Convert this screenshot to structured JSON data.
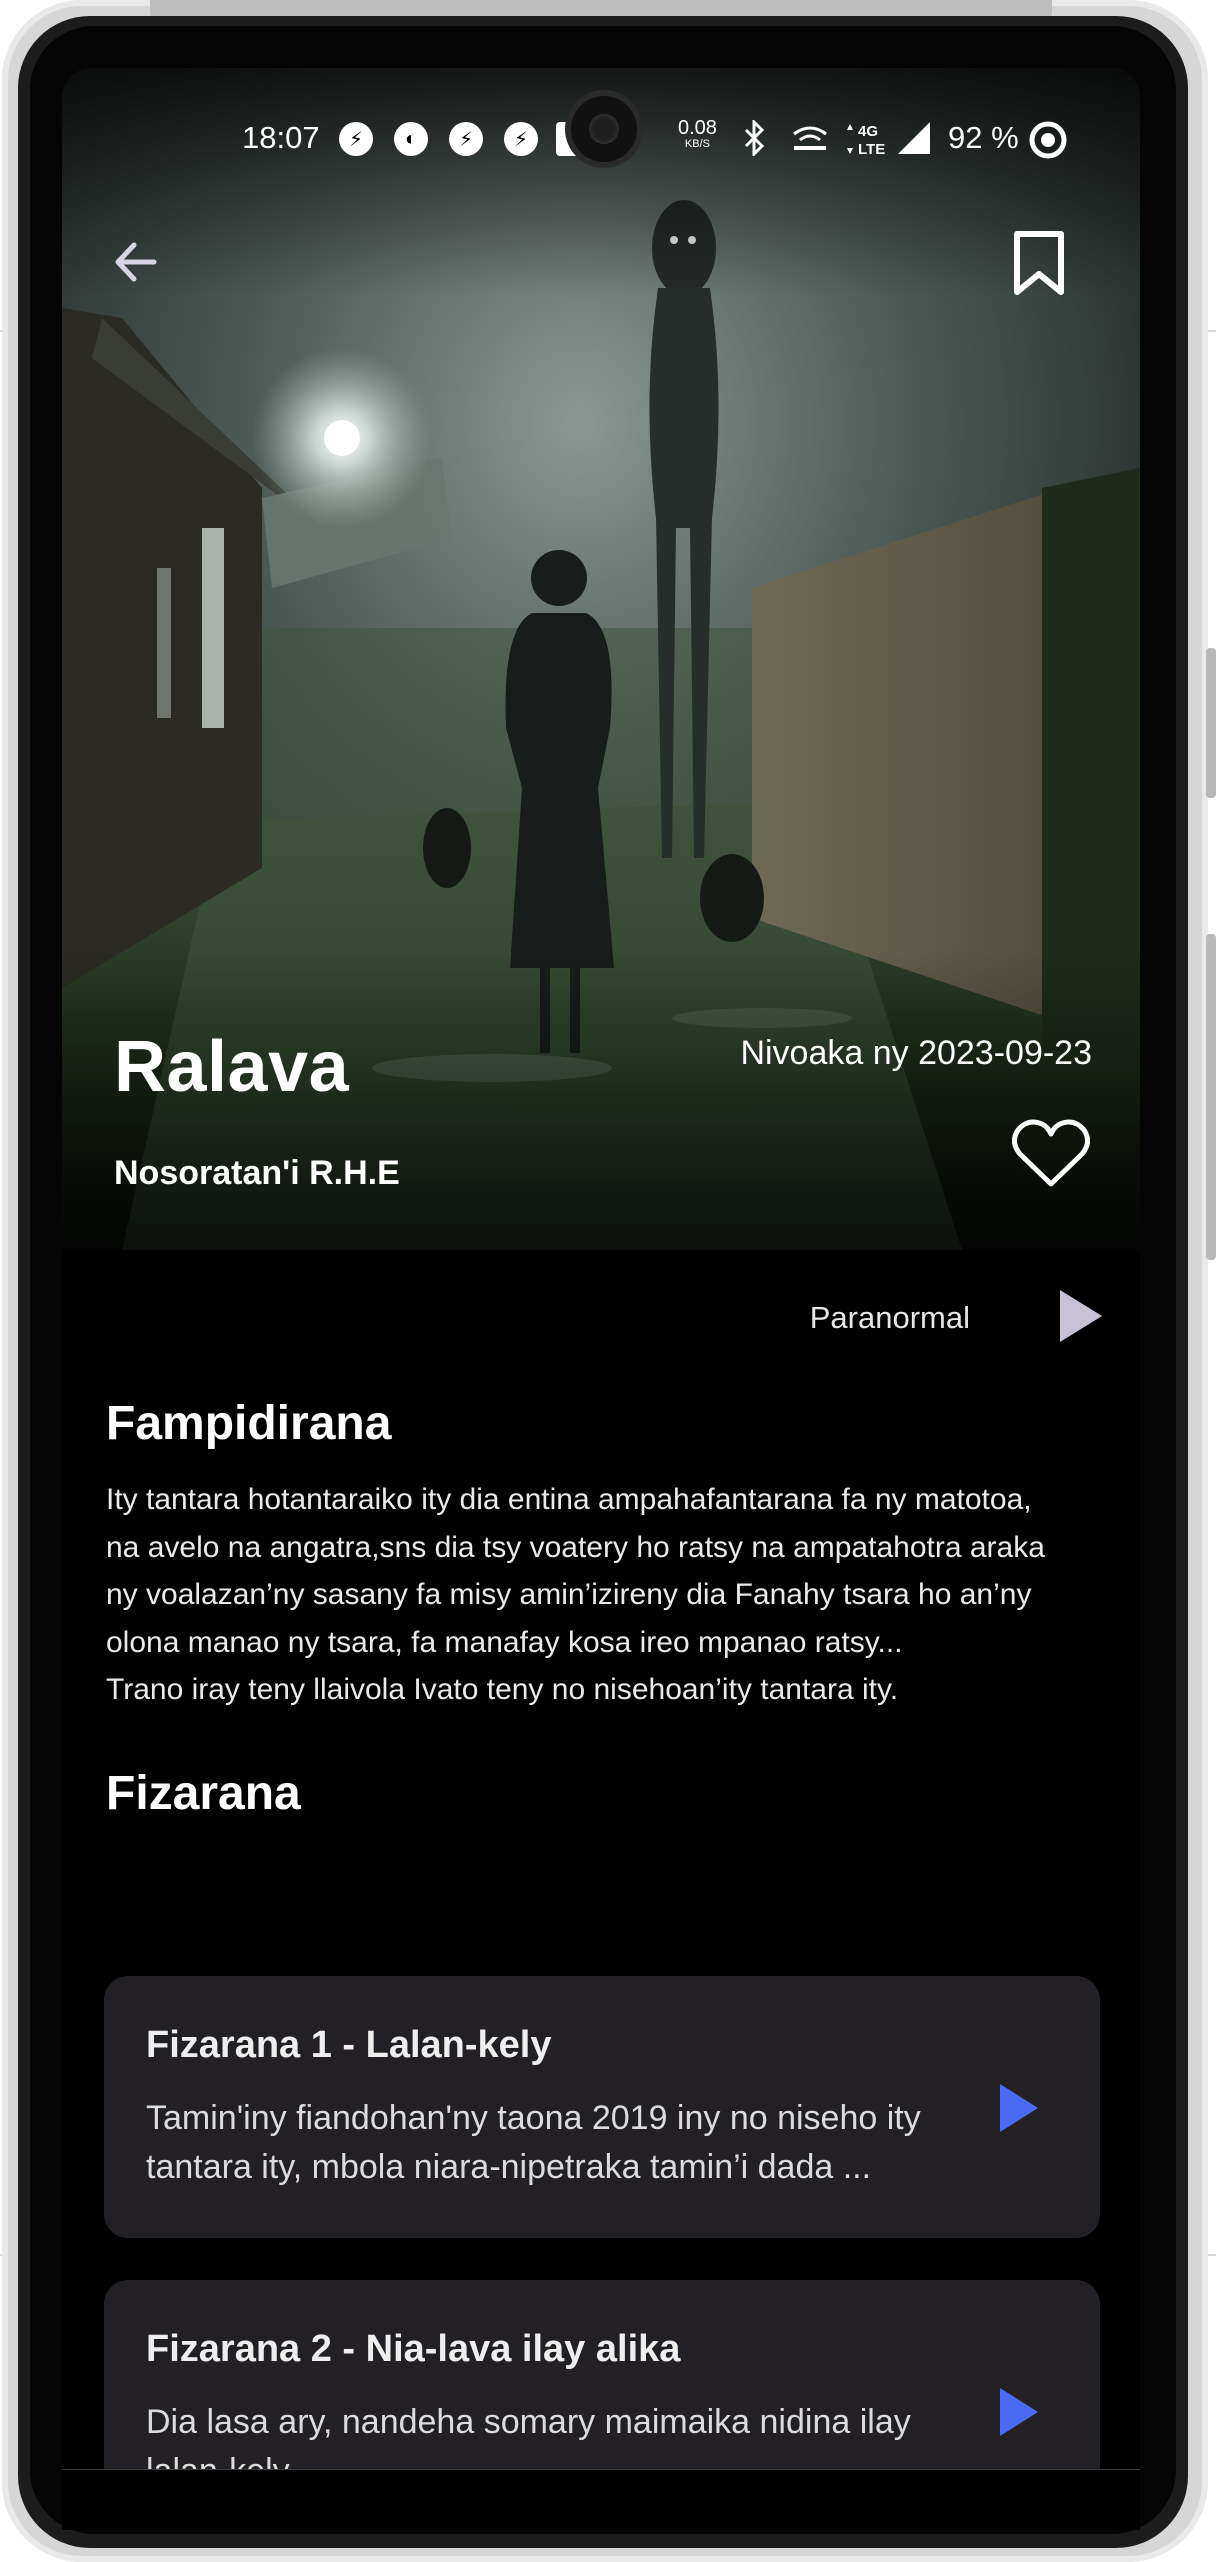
{
  "status_bar": {
    "time": "18:07",
    "notifications": [
      "messenger-icon",
      "app-icon",
      "messenger-icon",
      "messenger-icon",
      "image-icon"
    ],
    "net_speed_value": "0.08",
    "net_speed_unit": "KB/S",
    "network": "4G LTE",
    "battery": "92 %"
  },
  "hero": {
    "title": "Ralava",
    "release": "Nivoaka ny 2023-09-23",
    "author": "Nosoratan'i R.H.E"
  },
  "genre": {
    "label": "Paranormal"
  },
  "intro": {
    "heading": "Fampidirana",
    "text": "Ity tantara hotantaraiko ity dia entina ampahafantarana fa ny matotoa,\nna avelo na angatra,sns dia tsy voatery ho ratsy na ampatahotra araka\nny voalazan’ny sasany fa misy amin’izireny dia Fanahy tsara ho an’ny\nolona manao ny tsara, fa manafay kosa ireo mpanao ratsy...\nTrano iray teny llaivola Ivato teny no nisehoan’ity tantara ity."
  },
  "episodes_section": {
    "heading": "Fizarana",
    "items": [
      {
        "title": "Fizarana 1 - Lalan-kely",
        "desc": "Tamin'iny fiandohan'ny taona 2019 iny no niseho ity tantara ity, mbola niara-nipetraka tamin’i dada ..."
      },
      {
        "title": "Fizarana 2 - Nia-lava ilay alika",
        "desc": "Dia lasa ary,  nandeha somary maimaika nidina ilay lalan-kely"
      }
    ]
  },
  "colors": {
    "background": "#000000",
    "card": "#222025",
    "episode_play": "#4a6cf5",
    "genre_play": "#c9c2d6"
  }
}
